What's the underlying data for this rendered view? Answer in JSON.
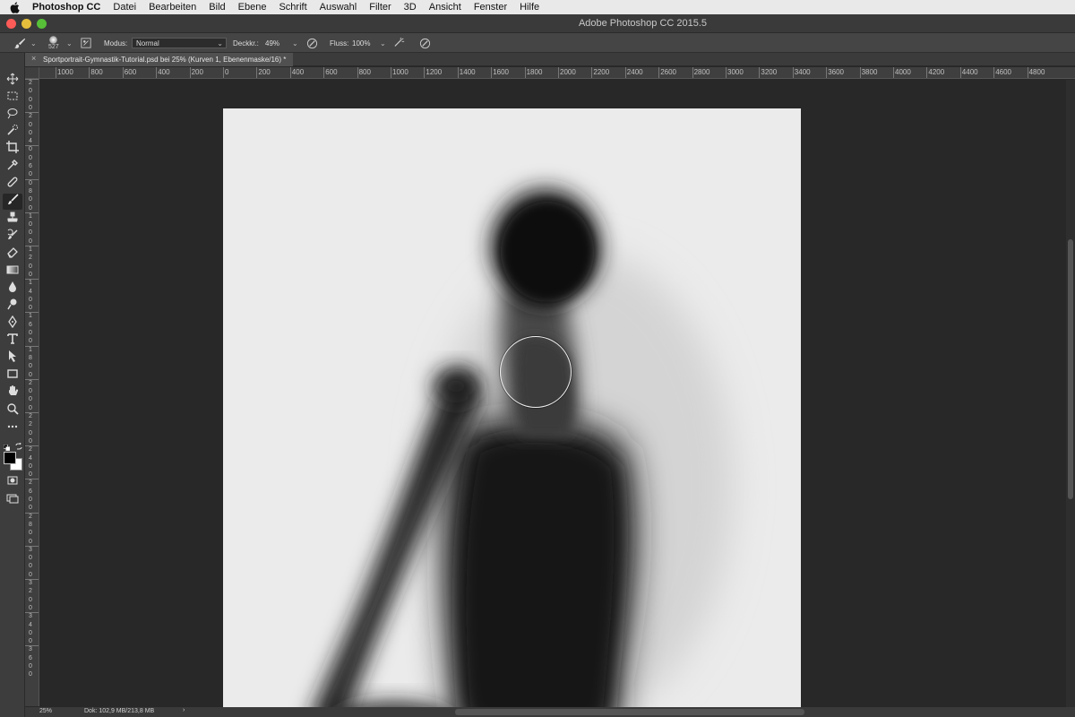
{
  "menubar": {
    "app_name": "Photoshop CC",
    "items": [
      "Datei",
      "Bearbeiten",
      "Bild",
      "Ebene",
      "Schrift",
      "Auswahl",
      "Filter",
      "3D",
      "Ansicht",
      "Fenster",
      "Hilfe"
    ]
  },
  "window": {
    "title": "Adobe Photoshop CC 2015.5"
  },
  "options": {
    "brush_size": "527",
    "mode_label": "Modus:",
    "mode_value": "Normal",
    "opacity_label": "Deckkr.:",
    "opacity_value": "49%",
    "flow_label": "Fluss:",
    "flow_value": "100%"
  },
  "document_tab": {
    "title": "Sportportrait-Gymnastik-Tutorial.psd bei 25% (Kurven 1, Ebenenmaske/16) *"
  },
  "ruler": {
    "h_labels": [
      "1000",
      "800",
      "600",
      "400",
      "200",
      "0",
      "200",
      "400",
      "600",
      "800",
      "1000",
      "1200",
      "1400",
      "1600",
      "1800",
      "2000",
      "2200",
      "2400",
      "2600",
      "2800",
      "3000",
      "3200",
      "3400",
      "3600",
      "3800",
      "4000",
      "4200",
      "4400",
      "4600",
      "4800"
    ],
    "v_labels": [
      "2",
      "0",
      "0",
      "0",
      "2",
      "0",
      "0",
      "4",
      "0",
      "0",
      "6",
      "0",
      "0",
      "8",
      "0",
      "0",
      "1",
      "0",
      "0",
      "0",
      "1",
      "2",
      "0",
      "0",
      "1",
      "4",
      "0",
      "0",
      "1",
      "6",
      "0",
      "0",
      "1",
      "8",
      "0",
      "0",
      "2",
      "0",
      "0",
      "0",
      "2",
      "2",
      "0",
      "0",
      "2",
      "4",
      "0",
      "0",
      "2",
      "6",
      "0",
      "0",
      "2",
      "8",
      "0",
      "0",
      "3",
      "0",
      "0",
      "0",
      "3",
      "2",
      "0",
      "0",
      "3",
      "4",
      "0",
      "0",
      "3",
      "6",
      "0",
      "0"
    ]
  },
  "tools": [
    "move-icon",
    "marquee-icon",
    "lasso-icon",
    "quick-select-icon",
    "crop-icon",
    "eyedropper-icon",
    "healing-icon",
    "brush-icon",
    "stamp-icon",
    "history-brush-icon",
    "eraser-icon",
    "gradient-icon",
    "blur-icon",
    "dodge-icon",
    "pen-icon",
    "type-icon",
    "path-select-icon",
    "rectangle-icon",
    "hand-icon",
    "zoom-icon",
    "more-tools-icon"
  ],
  "colors": {
    "foreground": "#000000",
    "background": "#ffffff"
  },
  "status": {
    "zoom": "25%",
    "doc_size": "Dok: 102,9 MB/213,8 MB",
    "arrow": "›"
  }
}
